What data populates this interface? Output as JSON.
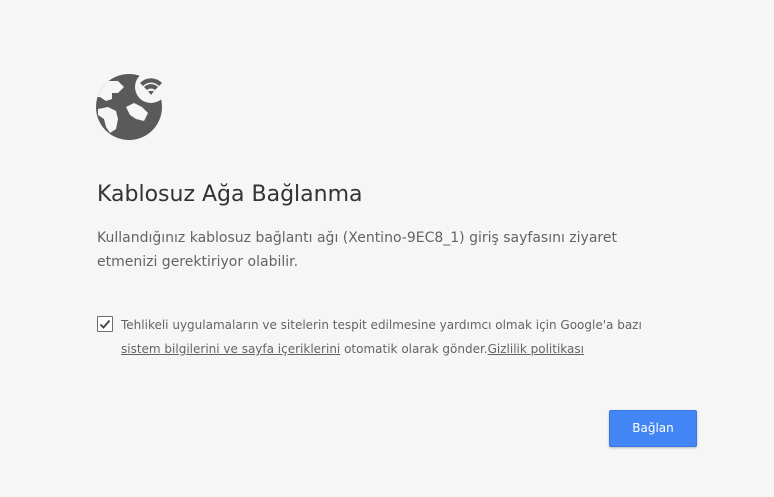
{
  "heading": "Kablosuz Ağa Bağlanma",
  "description": "Kullandığınız kablosuz bağlantı ağı (Xentino-9EC8_1) giriş sayfasını ziyaret etmenizi gerektiriyor olabilir.",
  "optin": {
    "checked": true,
    "text_before": "Tehlikeli uygulamaların ve sitelerin tespit edilmesine yardımcı olmak için Google'a bazı ",
    "link_system_info": "sistem bilgilerini ve sayfa içeriklerini",
    "text_middle": " otomatik olarak gönder.",
    "link_privacy": "Gizlilik politikası"
  },
  "connect_button_label": "Bağlan",
  "icon": "globe-wifi-icon",
  "colors": {
    "background": "#f6f6f6",
    "accent": "#4285f4",
    "icon": "#5a5a5a",
    "heading": "#333333",
    "text": "#646464"
  }
}
